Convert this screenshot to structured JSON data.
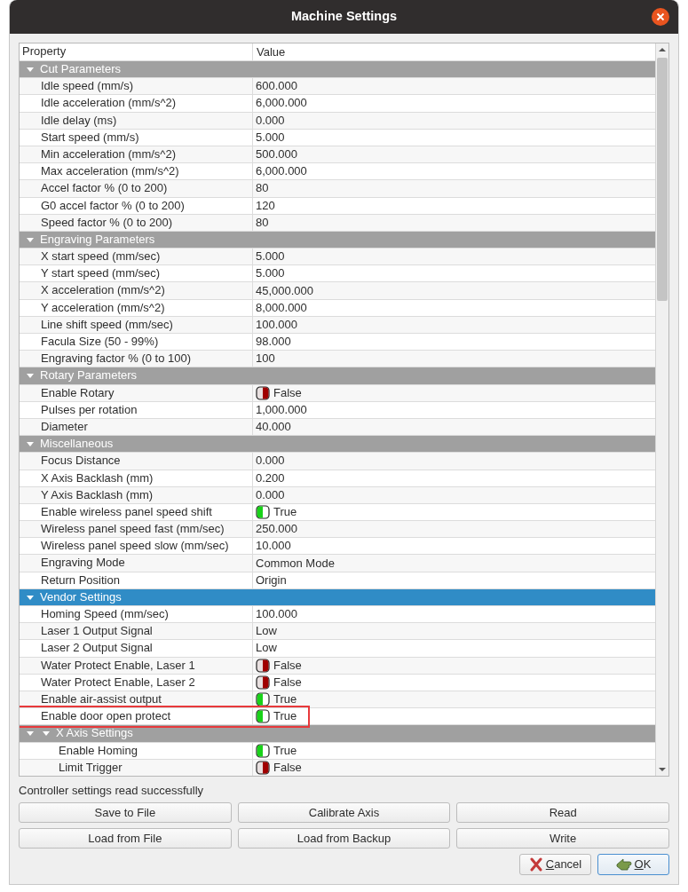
{
  "window": {
    "title": "Machine Settings"
  },
  "table": {
    "columns": [
      "Property",
      "Value"
    ],
    "rows": [
      {
        "kind": "group",
        "label": "Cut Parameters",
        "expanded": true,
        "selected": false,
        "children": [
          {
            "kind": "text",
            "property": "Idle speed (mm/s)",
            "value": "600.000",
            "selected": false,
            "highlighted": false
          },
          {
            "kind": "text",
            "property": "Idle acceleration (mm/s^2)",
            "value": "6,000.000",
            "selected": false,
            "highlighted": false
          },
          {
            "kind": "text",
            "property": "Idle delay (ms)",
            "value": "0.000",
            "selected": false,
            "highlighted": false
          },
          {
            "kind": "text",
            "property": "Start speed (mm/s)",
            "value": "5.000",
            "selected": false,
            "highlighted": false
          },
          {
            "kind": "text",
            "property": "Min acceleration (mm/s^2)",
            "value": "500.000",
            "selected": false,
            "highlighted": false
          },
          {
            "kind": "text",
            "property": "Max acceleration (mm/s^2)",
            "value": "6,000.000",
            "selected": false,
            "highlighted": false
          },
          {
            "kind": "text",
            "property": "Accel factor % (0 to 200)",
            "value": "80",
            "selected": false,
            "highlighted": false
          },
          {
            "kind": "text",
            "property": "G0 accel factor % (0 to 200)",
            "value": "120",
            "selected": false,
            "highlighted": false
          },
          {
            "kind": "text",
            "property": "Speed factor % (0 to 200)",
            "value": "80",
            "selected": false,
            "highlighted": false
          }
        ]
      },
      {
        "kind": "group",
        "label": "Engraving Parameters",
        "expanded": true,
        "selected": false,
        "children": [
          {
            "kind": "text",
            "property": "X start speed (mm/sec)",
            "value": "5.000",
            "selected": false,
            "highlighted": false
          },
          {
            "kind": "text",
            "property": "Y start speed (mm/sec)",
            "value": "5.000",
            "selected": false,
            "highlighted": false
          },
          {
            "kind": "text",
            "property": "X acceleration (mm/s^2)",
            "value": "45,000.000",
            "selected": false,
            "highlighted": false
          },
          {
            "kind": "text",
            "property": "Y acceleration (mm/s^2)",
            "value": "8,000.000",
            "selected": false,
            "highlighted": false
          },
          {
            "kind": "text",
            "property": "Line shift speed (mm/sec)",
            "value": "100.000",
            "selected": false,
            "highlighted": false
          },
          {
            "kind": "text",
            "property": "Facula Size (50 - 99%)",
            "value": "98.000",
            "selected": false,
            "highlighted": false
          },
          {
            "kind": "text",
            "property": "Engraving factor % (0 to 100)",
            "value": "100",
            "selected": false,
            "highlighted": false
          }
        ]
      },
      {
        "kind": "group",
        "label": "Rotary Parameters",
        "expanded": true,
        "selected": false,
        "children": [
          {
            "kind": "toggle",
            "property": "Enable Rotary",
            "on": false,
            "value": "False",
            "selected": false,
            "highlighted": false
          },
          {
            "kind": "text",
            "property": "Pulses per rotation",
            "value": "1,000.000",
            "selected": false,
            "highlighted": false
          },
          {
            "kind": "text",
            "property": "Diameter",
            "value": "40.000",
            "selected": false,
            "highlighted": false
          }
        ]
      },
      {
        "kind": "group",
        "label": "Miscellaneous",
        "expanded": true,
        "selected": false,
        "children": [
          {
            "kind": "text",
            "property": "Focus Distance",
            "value": "0.000",
            "selected": false,
            "highlighted": false
          },
          {
            "kind": "text",
            "property": "X Axis Backlash (mm)",
            "value": "0.200",
            "selected": false,
            "highlighted": false
          },
          {
            "kind": "text",
            "property": "Y Axis Backlash (mm)",
            "value": "0.000",
            "selected": false,
            "highlighted": false
          },
          {
            "kind": "toggle",
            "property": "Enable wireless panel speed shift",
            "on": true,
            "value": "True",
            "selected": false,
            "highlighted": false
          },
          {
            "kind": "text",
            "property": "Wireless panel speed fast (mm/sec)",
            "value": "250.000",
            "selected": false,
            "highlighted": false
          },
          {
            "kind": "text",
            "property": "Wireless panel speed slow (mm/sec)",
            "value": "10.000",
            "selected": false,
            "highlighted": false
          },
          {
            "kind": "text",
            "property": "Engraving Mode",
            "value": "Common Mode",
            "selected": false,
            "highlighted": false
          },
          {
            "kind": "text",
            "property": "Return Position",
            "value": "Origin",
            "selected": false,
            "highlighted": false
          }
        ]
      },
      {
        "kind": "group",
        "label": "Vendor Settings",
        "expanded": true,
        "selected": true,
        "children": [
          {
            "kind": "text",
            "property": "Homing Speed (mm/sec)",
            "value": "100.000",
            "selected": false,
            "highlighted": false
          },
          {
            "kind": "text",
            "property": "Laser 1 Output Signal",
            "value": "Low",
            "selected": false,
            "highlighted": false
          },
          {
            "kind": "text",
            "property": "Laser 2 Output Signal",
            "value": "Low",
            "selected": false,
            "highlighted": false
          },
          {
            "kind": "toggle",
            "property": "Water Protect Enable, Laser 1",
            "on": false,
            "value": "False",
            "selected": false,
            "highlighted": false
          },
          {
            "kind": "toggle",
            "property": "Water Protect Enable, Laser 2",
            "on": false,
            "value": "False",
            "selected": false,
            "highlighted": false
          },
          {
            "kind": "toggle",
            "property": "Enable air-assist output",
            "on": true,
            "value": "True",
            "selected": false,
            "highlighted": false
          },
          {
            "kind": "toggle",
            "property": "Enable door open protect",
            "on": true,
            "value": "True",
            "selected": false,
            "highlighted": true
          },
          {
            "kind": "group",
            "label": "X Axis Settings",
            "expanded": true,
            "selected": false,
            "children": [
              {
                "kind": "toggle",
                "property": "Enable Homing",
                "on": true,
                "value": "True",
                "selected": false,
                "highlighted": false
              },
              {
                "kind": "toggle",
                "property": "Limit Trigger",
                "on": false,
                "value": "False",
                "selected": false,
                "highlighted": false
              }
            ]
          }
        ]
      }
    ]
  },
  "status": "Controller settings read successfully",
  "actions": [
    "Save to File",
    "Calibrate Axis",
    "Read",
    "Load from File",
    "Load from Backup",
    "Write"
  ],
  "dialog_buttons": [
    {
      "kind": "cancel",
      "label": "Cancel",
      "default": false
    },
    {
      "kind": "ok",
      "label": "OK",
      "default": true
    }
  ]
}
